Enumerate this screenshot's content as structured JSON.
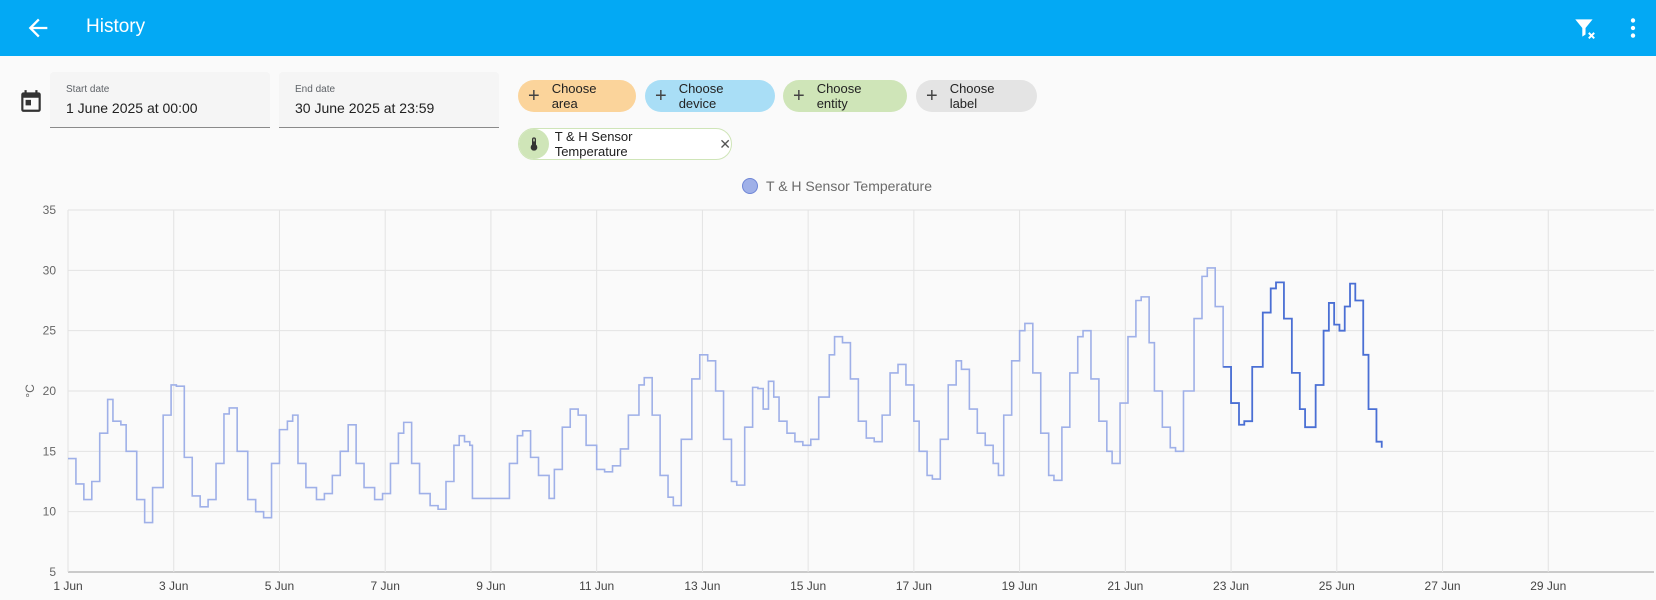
{
  "header": {
    "title": "History"
  },
  "icons": {
    "back": "arrow-left-icon",
    "clear_filter": "filter-remove-icon",
    "more": "dots-vertical-icon",
    "calendar": "calendar-icon",
    "thermometer": "thermometer-icon"
  },
  "date_range": {
    "start_label": "Start date",
    "start_value": "1 June 2025 at 00:00",
    "end_label": "End date",
    "end_value": "30 June 2025 at 23:59"
  },
  "target_picker": {
    "area": "Choose area",
    "device": "Choose device",
    "entity": "Choose entity",
    "label": "Choose label"
  },
  "selected_entity": {
    "name": "T & H Sensor Temperature"
  },
  "colors": {
    "header": "#03a9f4",
    "series_light": "#9fb0e8",
    "series_dark": "#4a6fd4"
  },
  "chart_data": {
    "type": "line",
    "legend": [
      "T & H Sensor Temperature"
    ],
    "ylabel": "°C",
    "ylim": [
      5,
      35
    ],
    "yticks": [
      5,
      10,
      15,
      20,
      25,
      30,
      35
    ],
    "xlim": [
      1,
      31
    ],
    "xticks": [
      1,
      3,
      5,
      7,
      9,
      11,
      13,
      15,
      17,
      19,
      21,
      23,
      25,
      27,
      29
    ],
    "xtick_labels": [
      "1 Jun",
      "3 Jun",
      "5 Jun",
      "7 Jun",
      "9 Jun",
      "11 Jun",
      "13 Jun",
      "15 Jun",
      "17 Jun",
      "19 Jun",
      "21 Jun",
      "23 Jun",
      "25 Jun",
      "27 Jun",
      "29 Jun"
    ],
    "grid": true,
    "series": [
      {
        "name": "T & H Sensor Temperature",
        "points": [
          [
            1.0,
            14.4
          ],
          [
            1.15,
            12.3
          ],
          [
            1.3,
            11.0
          ],
          [
            1.45,
            12.5
          ],
          [
            1.6,
            16.5
          ],
          [
            1.75,
            19.3
          ],
          [
            1.85,
            17.5
          ],
          [
            2.0,
            17.2
          ],
          [
            2.1,
            15.0
          ],
          [
            2.3,
            11.0
          ],
          [
            2.45,
            9.1
          ],
          [
            2.6,
            12.0
          ],
          [
            2.8,
            18.0
          ],
          [
            2.95,
            20.5
          ],
          [
            3.05,
            20.4
          ],
          [
            3.2,
            14.5
          ],
          [
            3.35,
            11.3
          ],
          [
            3.5,
            10.4
          ],
          [
            3.65,
            11.0
          ],
          [
            3.8,
            14.0
          ],
          [
            3.95,
            18.1
          ],
          [
            4.05,
            18.6
          ],
          [
            4.2,
            15.0
          ],
          [
            4.4,
            11.0
          ],
          [
            4.55,
            10.0
          ],
          [
            4.7,
            9.5
          ],
          [
            4.85,
            14.0
          ],
          [
            5.0,
            16.8
          ],
          [
            5.15,
            17.5
          ],
          [
            5.25,
            18.0
          ],
          [
            5.35,
            14.0
          ],
          [
            5.5,
            12.0
          ],
          [
            5.7,
            11.0
          ],
          [
            5.85,
            11.5
          ],
          [
            6.0,
            13.0
          ],
          [
            6.15,
            15.0
          ],
          [
            6.3,
            17.2
          ],
          [
            6.45,
            14.0
          ],
          [
            6.6,
            12.0
          ],
          [
            6.8,
            11.0
          ],
          [
            6.95,
            11.5
          ],
          [
            7.1,
            14.0
          ],
          [
            7.25,
            16.5
          ],
          [
            7.35,
            17.4
          ],
          [
            7.5,
            14.0
          ],
          [
            7.65,
            11.5
          ],
          [
            7.85,
            10.5
          ],
          [
            8.0,
            10.2
          ],
          [
            8.15,
            12.5
          ],
          [
            8.3,
            15.5
          ],
          [
            8.4,
            16.3
          ],
          [
            8.5,
            15.8
          ],
          [
            8.6,
            15.5
          ],
          [
            8.65,
            11.1
          ],
          [
            9.0,
            11.1
          ],
          [
            9.3,
            11.1
          ],
          [
            9.35,
            14.0
          ],
          [
            9.5,
            16.3
          ],
          [
            9.6,
            16.7
          ],
          [
            9.75,
            14.5
          ],
          [
            9.9,
            13.0
          ],
          [
            10.1,
            11.1
          ],
          [
            10.2,
            13.5
          ],
          [
            10.35,
            17.0
          ],
          [
            10.5,
            18.5
          ],
          [
            10.65,
            18.0
          ],
          [
            10.8,
            15.5
          ],
          [
            11.0,
            13.5
          ],
          [
            11.15,
            13.3
          ],
          [
            11.3,
            13.8
          ],
          [
            11.45,
            15.2
          ],
          [
            11.6,
            18.0
          ],
          [
            11.8,
            20.5
          ],
          [
            11.9,
            21.1
          ],
          [
            12.05,
            18.0
          ],
          [
            12.2,
            13.0
          ],
          [
            12.35,
            11.2
          ],
          [
            12.45,
            10.5
          ],
          [
            12.6,
            16.0
          ],
          [
            12.8,
            21.0
          ],
          [
            12.95,
            23.0
          ],
          [
            13.1,
            22.5
          ],
          [
            13.25,
            20.0
          ],
          [
            13.4,
            16.0
          ],
          [
            13.55,
            12.5
          ],
          [
            13.65,
            12.2
          ],
          [
            13.8,
            17.0
          ],
          [
            13.95,
            20.3
          ],
          [
            14.05,
            20.2
          ],
          [
            14.15,
            18.5
          ],
          [
            14.25,
            20.8
          ],
          [
            14.35,
            19.5
          ],
          [
            14.45,
            17.5
          ],
          [
            14.6,
            16.5
          ],
          [
            14.75,
            15.8
          ],
          [
            14.9,
            15.5
          ],
          [
            15.05,
            16.0
          ],
          [
            15.2,
            19.5
          ],
          [
            15.4,
            23.0
          ],
          [
            15.5,
            24.5
          ],
          [
            15.65,
            24.0
          ],
          [
            15.8,
            21.0
          ],
          [
            15.95,
            17.5
          ],
          [
            16.1,
            16.1
          ],
          [
            16.25,
            15.8
          ],
          [
            16.4,
            18.0
          ],
          [
            16.55,
            21.5
          ],
          [
            16.7,
            22.2
          ],
          [
            16.85,
            20.5
          ],
          [
            17.0,
            17.5
          ],
          [
            17.1,
            15.0
          ],
          [
            17.25,
            13.0
          ],
          [
            17.35,
            12.7
          ],
          [
            17.5,
            16.0
          ],
          [
            17.65,
            20.5
          ],
          [
            17.8,
            22.5
          ],
          [
            17.9,
            21.8
          ],
          [
            18.05,
            18.5
          ],
          [
            18.2,
            16.5
          ],
          [
            18.35,
            15.5
          ],
          [
            18.5,
            14.0
          ],
          [
            18.6,
            13.0
          ],
          [
            18.7,
            18.0
          ],
          [
            18.85,
            22.5
          ],
          [
            19.0,
            25.0
          ],
          [
            19.1,
            25.6
          ],
          [
            19.25,
            21.5
          ],
          [
            19.4,
            16.5
          ],
          [
            19.55,
            13.0
          ],
          [
            19.65,
            12.6
          ],
          [
            19.8,
            17.0
          ],
          [
            19.95,
            21.5
          ],
          [
            20.1,
            24.5
          ],
          [
            20.2,
            25.0
          ],
          [
            20.35,
            21.0
          ],
          [
            20.5,
            17.5
          ],
          [
            20.65,
            15.0
          ],
          [
            20.75,
            14.0
          ],
          [
            20.9,
            19.0
          ],
          [
            21.05,
            24.5
          ],
          [
            21.2,
            27.5
          ],
          [
            21.3,
            27.8
          ],
          [
            21.45,
            24.0
          ],
          [
            21.55,
            20.0
          ],
          [
            21.7,
            17.0
          ],
          [
            21.85,
            15.3
          ],
          [
            21.95,
            15.0
          ],
          [
            22.1,
            20.0
          ],
          [
            22.3,
            26.0
          ],
          [
            22.45,
            29.5
          ],
          [
            22.55,
            30.2
          ],
          [
            22.7,
            27.0
          ],
          [
            22.85,
            22.0
          ],
          [
            23.0,
            19.0
          ],
          [
            23.15,
            17.2
          ],
          [
            23.25,
            17.5
          ],
          [
            23.4,
            22.0
          ],
          [
            23.6,
            26.5
          ],
          [
            23.75,
            28.5
          ],
          [
            23.85,
            29.0
          ],
          [
            24.0,
            26.0
          ],
          [
            24.15,
            21.5
          ],
          [
            24.3,
            18.5
          ],
          [
            24.4,
            17.0
          ],
          [
            24.6,
            20.5
          ],
          [
            24.75,
            25.0
          ],
          [
            24.85,
            27.3
          ],
          [
            24.95,
            25.5
          ],
          [
            25.05,
            25.0
          ],
          [
            25.15,
            27.0
          ],
          [
            25.25,
            28.9
          ],
          [
            25.35,
            27.5
          ],
          [
            25.5,
            23.0
          ],
          [
            25.6,
            18.5
          ],
          [
            25.75,
            15.8
          ],
          [
            25.85,
            15.3
          ]
        ]
      }
    ]
  }
}
